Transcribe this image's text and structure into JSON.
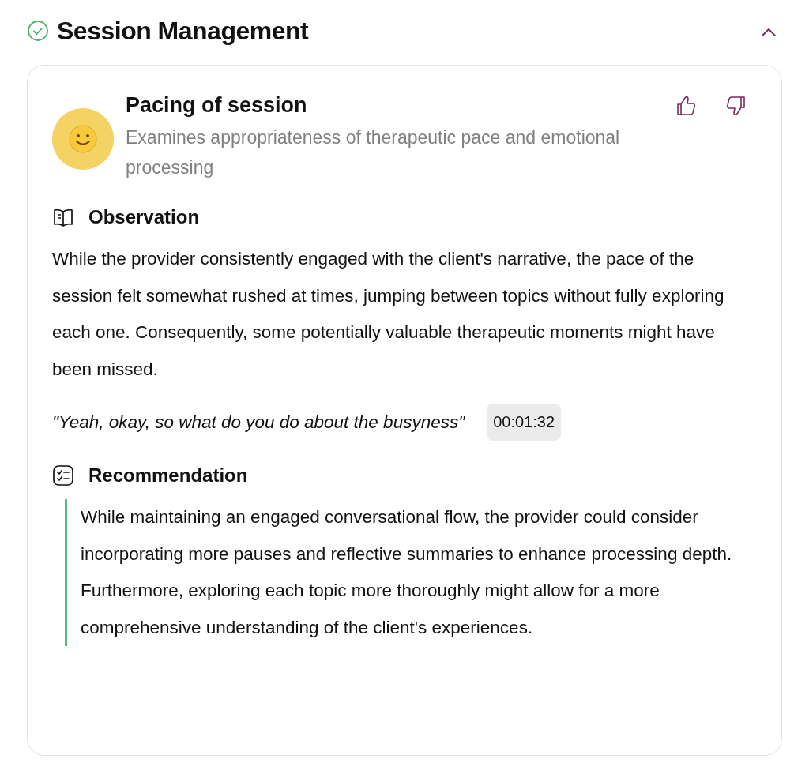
{
  "section": {
    "title": "Session Management",
    "completed": true,
    "expanded": true
  },
  "item": {
    "title": "Pacing of session",
    "description": "Examines appropriateness of therapeutic pace and emotional processing"
  },
  "observation": {
    "heading": "Observation",
    "text": "While the provider consistently engaged with the client's narrative, the pace of the session felt somewhat rushed at times, jumping between topics without fully exploring each one. Consequently, some potentially valuable therapeutic moments might have been missed.",
    "quote": "\"Yeah, okay, so what do you do about the busyness\"",
    "timestamp": "00:01:32"
  },
  "recommendation": {
    "heading": "Recommendation",
    "text": "While maintaining an engaged conversational flow, the provider could consider incorporating more pauses and reflective summaries to enhance processing depth. Furthermore, exploring each topic more thoroughly might allow for a more comprehensive understanding of the client's experiences."
  }
}
